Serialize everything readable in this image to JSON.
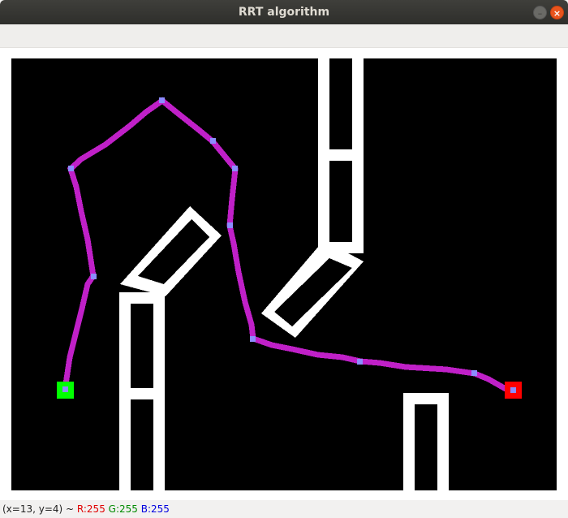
{
  "window": {
    "title": "RRT algorithm",
    "minimize_glyph": "–",
    "close_glyph": "×"
  },
  "status": {
    "coords": "(x=13, y=4) ~",
    "r": "R:255",
    "g": "G:255",
    "b": "B:255"
  },
  "colors": {
    "background": "#000000",
    "obstacle": "#ffffff",
    "path": "#c020c8",
    "node": "#8c8cff",
    "start": "#00ff00",
    "goal": "#ff0000"
  }
}
